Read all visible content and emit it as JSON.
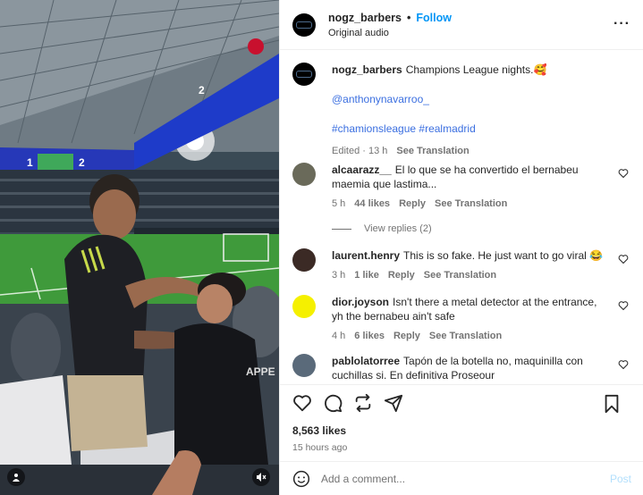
{
  "post": {
    "author": "nogz_barbers",
    "follow_label": "Follow",
    "audio": "Original audio",
    "caption_username": "nogz_barbers",
    "caption_text": "Champions League nights.🥰",
    "mention": "@anthonynavarroo_",
    "hashtags": "#chamionsleague #realmadrid",
    "edited": "Edited · 13 h",
    "see_translation": "See Translation"
  },
  "comments": [
    {
      "username": "alcaarazz__",
      "text": "El lo que se ha convertido el bernabeu maemia que lastima...",
      "age": "5 h",
      "likes": "44 likes",
      "reply": "Reply",
      "translate": "See Translation",
      "view_replies": "View replies (2)"
    },
    {
      "username": "laurent.henry",
      "text": "This is so fake. He just want to go viral 😂",
      "age": "3 h",
      "likes": "1 like",
      "reply": "Reply",
      "translate": "See Translation"
    },
    {
      "username": "dior.joyson",
      "text": "Isn't there a metal detector at the entrance, yh the bernabeu ain't safe",
      "age": "4 h",
      "likes": "6 likes",
      "reply": "Reply",
      "translate": "See Translation"
    },
    {
      "username": "pablolatorree",
      "text": "Tapón de la botella no, maquinilla con cuchillas si. En definitiva Proseour"
    }
  ],
  "stats": {
    "likes": "8,563 likes",
    "time": "15 hours ago"
  },
  "composer": {
    "placeholder": "Add a comment...",
    "post_label": "Post"
  },
  "media": {
    "scoreboard_left": "1",
    "scoreboard_right": "2",
    "ad_right": "2",
    "jersey_text": "APPE"
  },
  "icons": [
    "more-icon",
    "heart-icon",
    "comment-icon",
    "share-icon",
    "send-icon",
    "bookmark-icon",
    "emoji-icon",
    "user-tag-icon",
    "mute-icon"
  ],
  "colors": {
    "accent": "#0095f6",
    "link": "#00376b",
    "hashtag": "#3b6fe0"
  }
}
